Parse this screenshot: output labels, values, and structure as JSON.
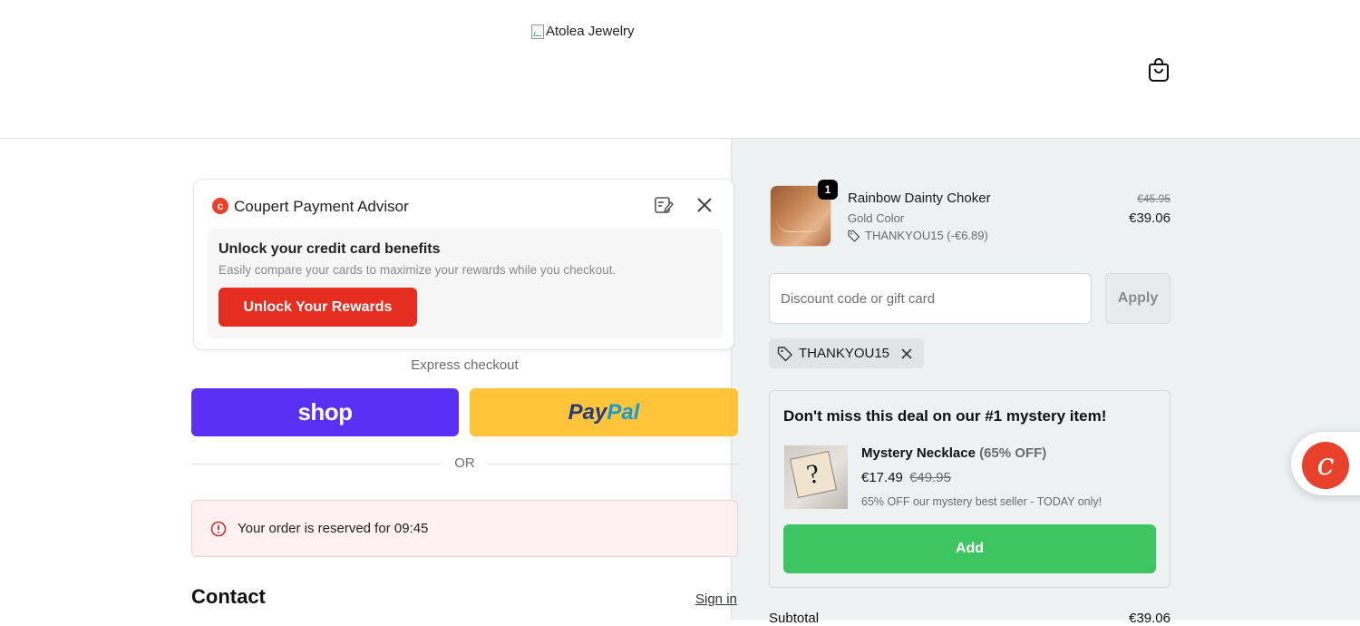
{
  "header": {
    "logo_alt": "Atolea Jewelry"
  },
  "coupert": {
    "logo_letter": "c",
    "title": "Coupert Payment Advisor",
    "card_title": "Unlock your credit card benefits",
    "card_subtitle": "Easily compare your cards to maximize your rewards while you checkout.",
    "button_label": "Unlock Your Rewards",
    "brand_color": "#e52e1f"
  },
  "express": {
    "label": "Express checkout",
    "shop_label": "shop",
    "paypal_part1": "Pay",
    "paypal_part2": "Pal",
    "or_label": "OR"
  },
  "reservation": {
    "text": "Your order is reserved for 09:45"
  },
  "contact": {
    "heading": "Contact",
    "signin_label": "Sign in"
  },
  "cart_item": {
    "quantity": "1",
    "name": "Rainbow Dainty Choker",
    "variant": "Gold Color",
    "discount": "THANKYOU15 (-€6.89)",
    "price_original": "€45.95",
    "price_current": "€39.06"
  },
  "discount": {
    "placeholder": "Discount code or gift card",
    "apply_label": "Apply",
    "applied_code": "THANKYOU15"
  },
  "upsell": {
    "title": "Don't miss this deal on our #1 mystery item!",
    "product_name": "Mystery Necklace",
    "product_off": "(65% OFF)",
    "price_current": "€17.49",
    "price_original": "€49.95",
    "description": "65% OFF our mystery best seller - TODAY only!",
    "add_label": "Add",
    "button_color": "#3cc560"
  },
  "totals": {
    "subtotal_label": "Subtotal",
    "subtotal_value": "€39.06"
  },
  "colors": {
    "shop_purple": "#5a31f4",
    "paypal_yellow": "#ffc439",
    "summary_bg": "#eef1f1"
  }
}
